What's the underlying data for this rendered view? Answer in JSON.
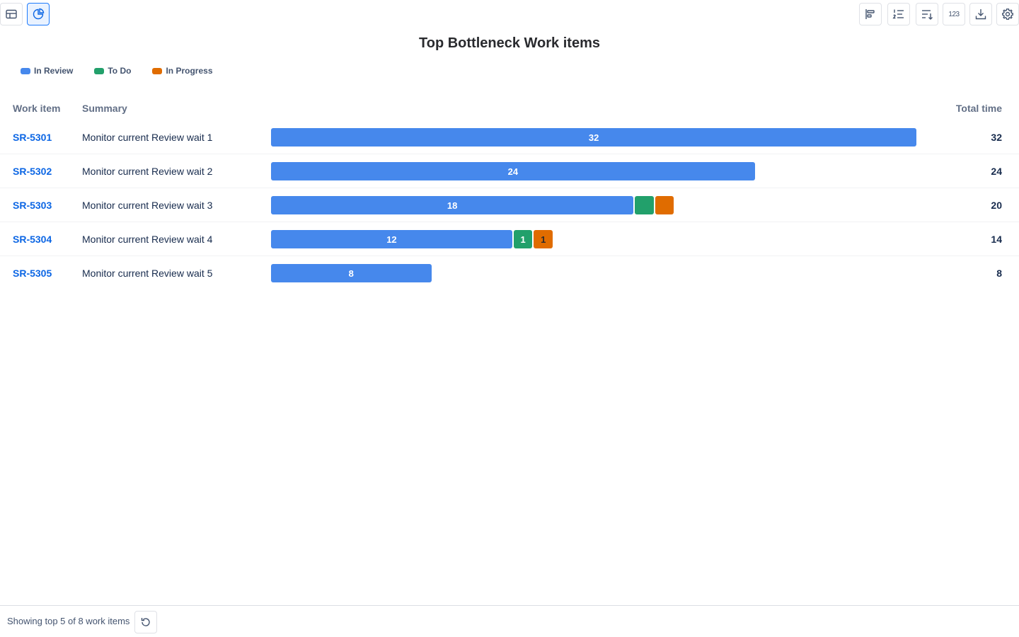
{
  "toolbar": {
    "left": [
      {
        "name": "table-view-icon",
        "active": false
      },
      {
        "name": "chart-view-icon",
        "active": true
      }
    ],
    "right": [
      {
        "name": "bar-align-icon"
      },
      {
        "name": "numbered-list-icon"
      },
      {
        "name": "sort-icon"
      },
      {
        "name": "number-format-icon",
        "text": "123"
      },
      {
        "name": "download-icon"
      },
      {
        "name": "settings-icon"
      }
    ]
  },
  "chart_data": {
    "type": "bar",
    "stacked": true,
    "orientation": "horizontal",
    "title": "Top Bottleneck Work items",
    "legend": [
      {
        "label": "In Review",
        "color": "#4688ec"
      },
      {
        "label": "To Do",
        "color": "#22a06b"
      },
      {
        "label": "In Progress",
        "color": "#e06c00"
      }
    ],
    "columns": {
      "key": "Work item",
      "summary": "Summary",
      "total": "Total time"
    },
    "xlim": [
      0,
      33.6
    ],
    "rows": [
      {
        "key": "SR-5301",
        "summary": "Monitor current Review wait 1",
        "values": [
          32,
          0,
          0
        ],
        "labels": [
          "32",
          "",
          ""
        ],
        "total": "32"
      },
      {
        "key": "SR-5302",
        "summary": "Monitor current Review wait 2",
        "values": [
          24,
          0,
          0
        ],
        "labels": [
          "24",
          "",
          ""
        ],
        "total": "24"
      },
      {
        "key": "SR-5303",
        "summary": "Monitor current Review wait 3",
        "values": [
          18,
          1,
          1
        ],
        "labels": [
          "18",
          "",
          ""
        ],
        "total": "20"
      },
      {
        "key": "SR-5304",
        "summary": "Monitor current Review wait 4",
        "values": [
          12,
          1,
          1
        ],
        "labels": [
          "12",
          "1",
          "1"
        ],
        "total": "14"
      },
      {
        "key": "SR-5305",
        "summary": "Monitor current Review wait 5",
        "values": [
          8,
          0,
          0
        ],
        "labels": [
          "8",
          "",
          ""
        ],
        "total": "8"
      }
    ]
  },
  "footer": {
    "status": "Showing top 5 of 8 work items",
    "refresh_icon": "refresh-icon"
  }
}
